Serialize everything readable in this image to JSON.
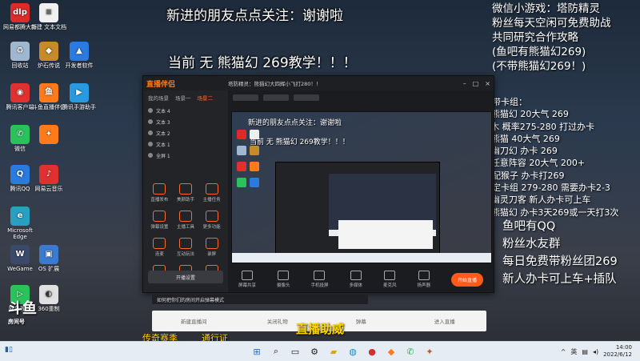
{
  "overlay": {
    "top_title": "新进的朋友点点关注：谢谢啦",
    "sub_title": "当前 无 熊猫幻 269教学！！！"
  },
  "right_panel": {
    "lines": [
      "微信小游戏：塔防精灵",
      "粉丝每天空闲可免费助战",
      "共同研究合作攻略",
      "(鱼吧有熊猫幻269)",
      "(不带熊猫幻269！)"
    ]
  },
  "guide": {
    "lines": [
      "白带卡组：",
      "①熊猫幻 20大气 269",
      "   +木   概率275-280  打过办卡",
      "②熊猫         40大气 269",
      "③幽刀幻          办卡  269",
      "④任意阵容        20大气 200+",
      "   低配猴子           办卡打269",
      "   特定卡组   279-280 需要办卡2-3",
      "⑤幽灵刀客   新人办卡可上车",
      "⑥熊猫幻     办卡3天269或一天打3次"
    ]
  },
  "qq": {
    "lines": [
      "鱼吧有QQ",
      "粉丝水友群",
      "每日免费带粉丝团269",
      "新人办卡可上车+插队"
    ]
  },
  "desktop_icons": [
    {
      "label": "网易都腾大师",
      "color": "#e02a2a",
      "glyph": "dlp"
    },
    {
      "label": "新建 文本文档",
      "color": "#f1f1f1",
      "glyph": "≡"
    },
    {
      "label": "回收站",
      "color": "#9fb7cf",
      "glyph": "♻"
    },
    {
      "label": "炉石传说",
      "color": "#c58a2a",
      "glyph": "◆"
    },
    {
      "label": "开发者软件",
      "color": "#2a7ae0",
      "glyph": "▲"
    },
    {
      "label": "腾讯客户端",
      "color": "#e03030",
      "glyph": "◉"
    },
    {
      "label": "斗鱼直播伴侣",
      "color": "#ff7a1a",
      "glyph": "鱼"
    },
    {
      "label": "腾讯手游助手",
      "color": "#2a9ae0",
      "glyph": "▶"
    },
    {
      "label": "微信",
      "color": "#2ac25a",
      "glyph": "✆"
    },
    {
      "label": "",
      "color": "#ff7a1a",
      "glyph": "✦"
    },
    {
      "label": "腾讯QQ",
      "color": "#2a7ae0",
      "glyph": "Q"
    },
    {
      "label": "网易云音乐",
      "color": "#e03030",
      "glyph": "♪"
    },
    {
      "label": "Microsoft Edge",
      "color": "#2aa0c0",
      "glyph": "e"
    },
    {
      "label": "WeGame",
      "color": "#3a4a6a",
      "glyph": "W"
    },
    {
      "label": "OS 扩展",
      "color": "#3a7ad0",
      "glyph": "▣"
    },
    {
      "label": "网易视频",
      "color": "#2ac25a",
      "glyph": "▷"
    },
    {
      "label": "360重制",
      "color": "#e0e0e0",
      "glyph": "◐"
    }
  ],
  "window": {
    "logo": "直播伴侣",
    "title": "塔防精灵：熊猫幻大四辉小飞打280！！",
    "tabs": [
      "我的场景",
      "场景一",
      "场景二"
    ],
    "sources": [
      "文本 4",
      "文本 3",
      "文本 2",
      "文本 1",
      "全屏 1"
    ],
    "tools": [
      "直播发布",
      "美颜助手",
      "主播任务",
      "弹幕设置",
      "主播工具",
      "更多功能",
      "连麦",
      "互动玩法",
      "录屏",
      "直播间",
      "弹幕助手",
      "抽奖"
    ],
    "bottom_button": "开播设置",
    "controls": [
      "屏幕共享",
      "摄像头",
      "手机投屏",
      "多媒体",
      "麦克风",
      "扬声器"
    ],
    "start_label": "开始直播"
  },
  "chatbar": {
    "items": [
      "新建直播间",
      "关闭礼物",
      "弹幕",
      "进入直播"
    ]
  },
  "notice": "如何把你们的房间开启弹幕模式",
  "promo": "直播助威",
  "promo2": "传奇赛季",
  "promo3": "通行证",
  "douyu": {
    "name": "斗鱼",
    "sub": "房间号"
  },
  "taskbar": {
    "lang": "英",
    "time": "14:00",
    "date": "2022/6/12",
    "icons": [
      "start-icon",
      "search-icon",
      "task-view-icon",
      "widgets-icon",
      "file-explorer-icon",
      "edge-icon",
      "netease-music-icon",
      "wechat-icon",
      "douyu-icon",
      "game-icon"
    ]
  }
}
